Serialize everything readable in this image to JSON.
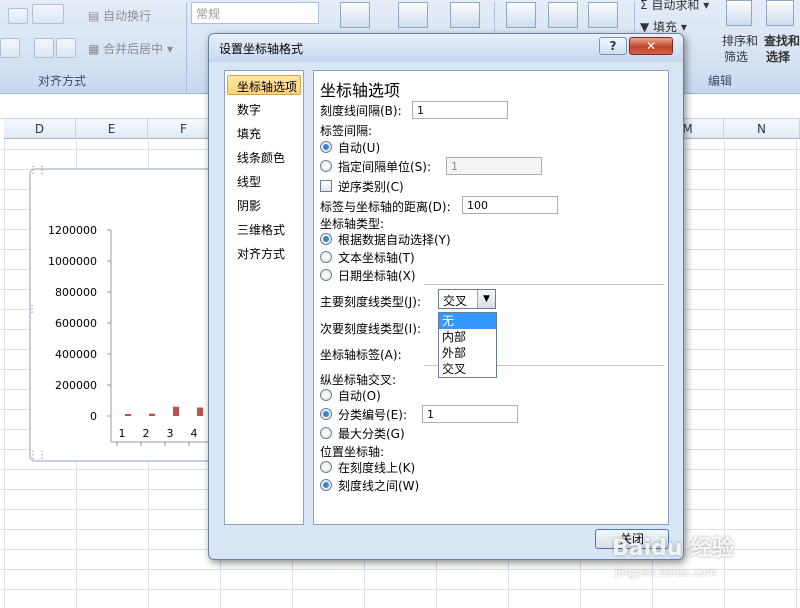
{
  "ribbon": {
    "wrap_text": "自动换行",
    "merge_center": "合并后居中",
    "number_format": "常规",
    "autosum": "自动求和",
    "fill": "填充",
    "sort_filter_line1": "排序和",
    "sort_filter_line2": "筛选",
    "find_select_line1": "查找和",
    "find_select_line2": "选择",
    "group_alignment": "对齐方式",
    "group_editing": "编辑"
  },
  "sheet": {
    "columns": [
      "D",
      "E",
      "F",
      "M",
      "N"
    ]
  },
  "chart_data": {
    "type": "bar",
    "categories": [
      "1",
      "2",
      "3",
      "4"
    ],
    "values": [
      8000,
      15000,
      60000,
      55000
    ],
    "y_ticks": [
      "1200000",
      "1000000",
      "800000",
      "600000",
      "400000",
      "200000",
      "0"
    ],
    "ylim": [
      0,
      1200000
    ],
    "bar_color": "#c0504d"
  },
  "dialog": {
    "title": "设置坐标轴格式",
    "help_label": "?",
    "close_label": "✕",
    "nav": [
      "坐标轴选项",
      "数字",
      "填充",
      "线条颜色",
      "线型",
      "阴影",
      "三维格式",
      "对齐方式"
    ],
    "heading": "坐标轴选项",
    "tick_interval_label": "刻度线间隔(B):",
    "tick_interval_value": "1",
    "label_interval_label": "标签间隔:",
    "auto_label": "自动(U)",
    "specify_unit_label": "指定间隔单位(S):",
    "specify_unit_value": "1",
    "reverse_label": "逆序类别(C)",
    "label_distance_label": "标签与坐标轴的距离(D):",
    "label_distance_value": "100",
    "axis_type_label": "坐标轴类型:",
    "axis_type_auto": "根据数据自动选择(Y)",
    "axis_type_text": "文本坐标轴(T)",
    "axis_type_date": "日期坐标轴(X)",
    "major_tick_label": "主要刻度线类型(J):",
    "major_tick_value": "交叉",
    "major_tick_options": [
      "无",
      "内部",
      "外部",
      "交叉"
    ],
    "minor_tick_label": "次要刻度线类型(I):",
    "axis_labels_label": "坐标轴标签(A):",
    "vertical_cross_label": "纵坐标轴交叉:",
    "cross_auto": "自动(O)",
    "cross_category_no": "分类编号(E):",
    "cross_category_value": "1",
    "cross_max_category": "最大分类(G)",
    "position_label": "位置坐标轴:",
    "on_tick_marks": "在刻度线上(K)",
    "between_tick_marks": "刻度线之间(W)",
    "close_button": "关闭"
  },
  "watermark": {
    "brand": "Baidu 经验",
    "url": "jingyan.baidu.com"
  }
}
